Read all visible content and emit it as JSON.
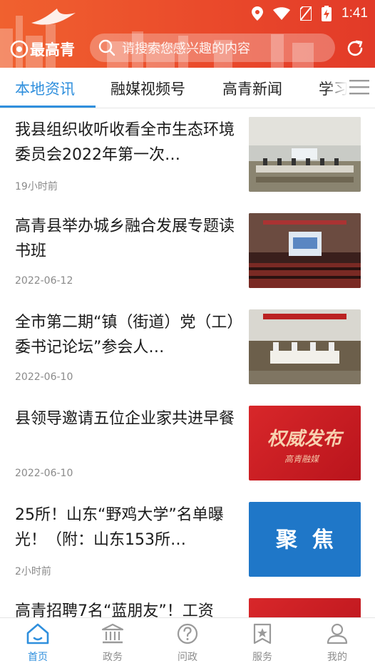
{
  "status_bar": {
    "time": "1:41"
  },
  "header": {
    "brand_name": "最高青",
    "search_placeholder": "请搜索您感兴趣的内容",
    "brand_color": "#ea4a2b"
  },
  "tabs": [
    {
      "label": "本地资讯",
      "active": true
    },
    {
      "label": "融媒视频号",
      "active": false
    },
    {
      "label": "高青新闻",
      "active": false
    },
    {
      "label": "学习",
      "active": false
    }
  ],
  "accent_color": "#2f8fdd",
  "news": [
    {
      "title": "我县组织收听收看全市生态环境委员会2022年第一次…",
      "time": "19小时前",
      "thumb": "meeting-room-photo"
    },
    {
      "title": "高青县举办城乡融合发展专题读书班",
      "time": "2022-06-12",
      "thumb": "auditorium-photo"
    },
    {
      "title": "全市第二期“镇（街道）党（工）委书记论坛”参会人…",
      "time": "2022-06-10",
      "thumb": "forum-photo"
    },
    {
      "title": "县领导邀请五位企业家共进早餐",
      "time": "2022-06-10",
      "thumb": "authority-release-banner",
      "banner_text": "权威发布",
      "banner_sub": "高青融媒"
    },
    {
      "title": "25所！山东“野鸡大学”名单曝光！（附：山东153所…",
      "time": "2小时前",
      "thumb": "focus-banner",
      "banner_text": "聚  焦"
    },
    {
      "title": "高青招聘7名“蓝朋友”！工资",
      "time": "",
      "thumb": "red-banner"
    }
  ],
  "bottom_nav": [
    {
      "label": "首页",
      "icon": "home-icon",
      "active": true
    },
    {
      "label": "政务",
      "icon": "government-building-icon",
      "active": false
    },
    {
      "label": "问政",
      "icon": "question-icon",
      "active": false
    },
    {
      "label": "服务",
      "icon": "service-star-icon",
      "active": false
    },
    {
      "label": "我的",
      "icon": "profile-icon",
      "active": false
    }
  ]
}
